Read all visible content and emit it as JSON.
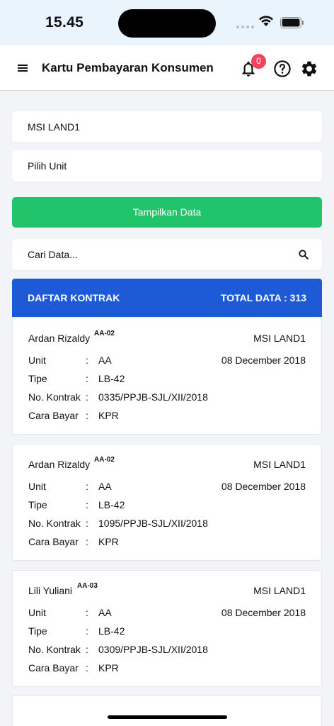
{
  "status_bar": {
    "time": "15.45"
  },
  "app_bar": {
    "title": "Kartu Pembayaran Konsumen",
    "notification_count": "0"
  },
  "filters": {
    "project": "MSI LAND1",
    "unit": "Pilih Unit",
    "show_button": "Tampilkan Data",
    "search_placeholder": "Cari Data..."
  },
  "list": {
    "header_left": "DAFTAR KONTRAK",
    "header_right": "TOTAL DATA : 313",
    "row_labels": {
      "unit": "Unit",
      "tipe": "Tipe",
      "kontrak": "No. Kontrak",
      "bayar": "Cara Bayar",
      "colon": ":"
    },
    "items": [
      {
        "name": "Ardan Rizaldy",
        "code": "AA-02",
        "project": "MSI LAND1",
        "date": "08 December 2018",
        "unit": "AA",
        "tipe": "LB-42",
        "kontrak": "0335/PPJB-SJL/XII/2018",
        "bayar": "KPR"
      },
      {
        "name": "Ardan Rizaldy",
        "code": "AA-02",
        "project": "MSI LAND1",
        "date": "08 December 2018",
        "unit": "AA",
        "tipe": "LB-42",
        "kontrak": "1095/PPJB-SJL/XII/2018",
        "bayar": "KPR"
      },
      {
        "name": "Lili Yuliani",
        "code": "AA-03",
        "project": "MSI LAND1",
        "date": "08 December 2018",
        "unit": "AA",
        "tipe": "LB-42",
        "kontrak": "0309/PPJB-SJL/XII/2018",
        "bayar": "KPR"
      }
    ]
  },
  "colors": {
    "primary": "#1f5ad6",
    "success": "#21c36b",
    "badge": "#f0455a"
  }
}
